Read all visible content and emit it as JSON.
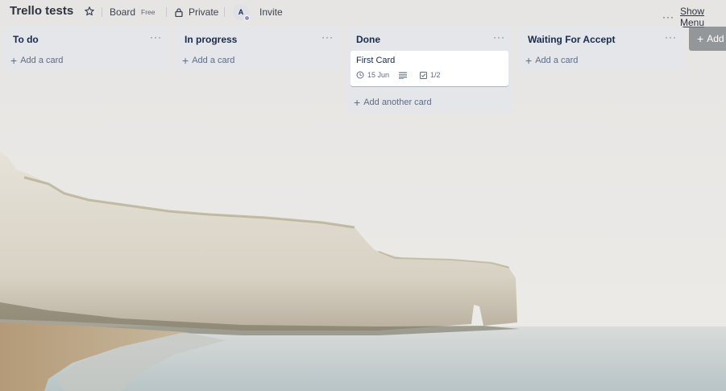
{
  "board": {
    "title": "Trello tests",
    "visibility_label": "Board",
    "plan_badge": "Free",
    "privacy_label": "Private",
    "invite_label": "Invite",
    "avatar_initial": "A",
    "show_menu_label": "Show Menu",
    "more_label": "···"
  },
  "lists": [
    {
      "title": "To do",
      "menu": "···",
      "cards": [],
      "add_label": "Add a card"
    },
    {
      "title": "In progress",
      "menu": "···",
      "cards": [],
      "add_label": "Add a card"
    },
    {
      "title": "Done",
      "menu": "···",
      "cards": [
        {
          "title": "First Card",
          "due": "15 Jun",
          "checklist": "1/2",
          "has_description": true
        }
      ],
      "add_label": "Add another card"
    },
    {
      "title": "Waiting For Accept",
      "menu": "···",
      "cards": [],
      "add_label": "Add a card"
    }
  ],
  "add_list_label": "Add",
  "colors": {
    "list_bg": "#e4e6ea",
    "text_primary": "#172b4d",
    "text_secondary": "#5e6c84",
    "sky": "#e9e6e3",
    "cliff": "#e2ddd2",
    "sea": "#c9d0d0",
    "sand": "#b79d7d"
  },
  "icons": {
    "star": "star-icon",
    "lock": "lock-icon",
    "clock": "clock-icon",
    "description": "description-icon",
    "checklist": "checklist-icon",
    "plus": "plus-icon",
    "more": "more-icon"
  }
}
